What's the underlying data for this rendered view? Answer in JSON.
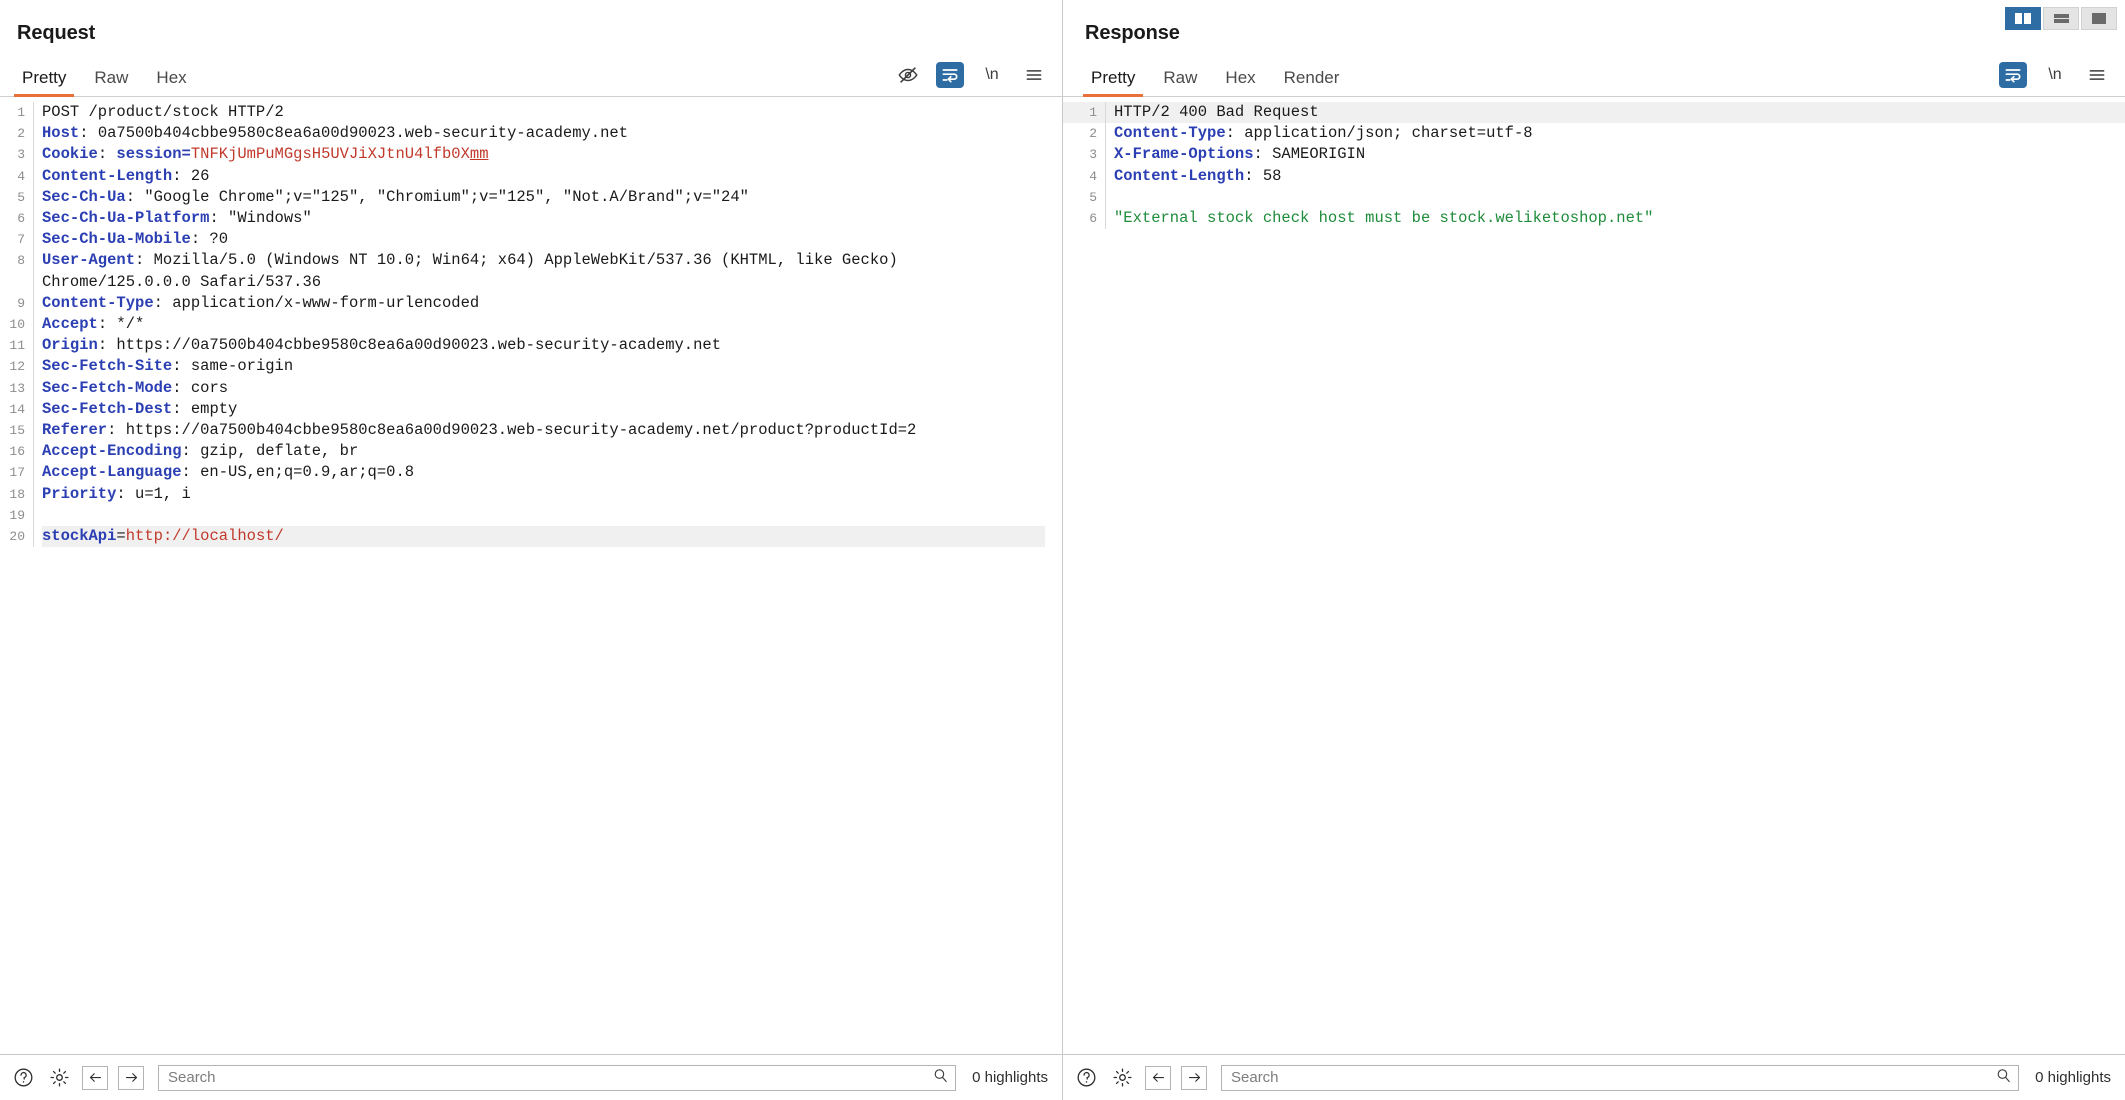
{
  "layout_toggle": {
    "buttons": [
      {
        "name": "side-by-side-layout",
        "label": "Side by side",
        "active": true
      },
      {
        "name": "stacked-layout",
        "label": "Stacked",
        "active": false
      },
      {
        "name": "single-layout",
        "label": "Single",
        "active": false
      }
    ]
  },
  "accent": {
    "tab_underline": "#e8703a",
    "active_tool": "#2e6da4",
    "header_blue": "#2b3fb3",
    "value_red": "#c0392b",
    "value_green": "#1e8c3a",
    "row_highlight": "#f0f0f0"
  },
  "request": {
    "title": "Request",
    "tabs": [
      {
        "label": "Pretty",
        "active": true
      },
      {
        "label": "Raw",
        "active": false
      },
      {
        "label": "Hex",
        "active": false
      }
    ],
    "tools": [
      {
        "name": "eye-off-icon",
        "label": "Show non-printable characters",
        "active": false
      },
      {
        "name": "word-wrap-icon",
        "label": "Word wrap",
        "active": true
      },
      {
        "name": "newline-icon",
        "label": "\\n",
        "active": false
      },
      {
        "name": "menu-icon",
        "label": "Menu",
        "active": false
      }
    ],
    "lines": [
      {
        "num": "1",
        "segments": [
          {
            "text": "POST /product/stock HTTP/2",
            "style": "plain"
          }
        ]
      },
      {
        "num": "2",
        "segments": [
          {
            "text": "Host",
            "style": "hdr"
          },
          {
            "text": ": 0a7500b404cbbe9580c8ea6a00d90023.web-security-academy.net",
            "style": "plain"
          }
        ]
      },
      {
        "num": "3",
        "segments": [
          {
            "text": "Cookie",
            "style": "hdr"
          },
          {
            "text": ": ",
            "style": "plain"
          },
          {
            "text": "session=",
            "style": "hdr"
          },
          {
            "text": "TNFKjUmPuMGgsH5UVJiXJtnU4lfb0X",
            "style": "red"
          },
          {
            "text": "mm",
            "style": "red-u"
          }
        ]
      },
      {
        "num": "4",
        "segments": [
          {
            "text": "Content-Length",
            "style": "hdr"
          },
          {
            "text": ": 26",
            "style": "plain"
          }
        ]
      },
      {
        "num": "5",
        "segments": [
          {
            "text": "Sec-Ch-Ua",
            "style": "hdr"
          },
          {
            "text": ": \"Google Chrome\";v=\"125\", \"Chromium\";v=\"125\", \"Not.A/Brand\";v=\"24\"",
            "style": "plain"
          }
        ]
      },
      {
        "num": "6",
        "segments": [
          {
            "text": "Sec-Ch-Ua-Platform",
            "style": "hdr"
          },
          {
            "text": ": \"Windows\"",
            "style": "plain"
          }
        ]
      },
      {
        "num": "7",
        "segments": [
          {
            "text": "Sec-Ch-Ua-Mobile",
            "style": "hdr"
          },
          {
            "text": ": ?0",
            "style": "plain"
          }
        ]
      },
      {
        "num": "8",
        "segments": [
          {
            "text": "User-Agent",
            "style": "hdr"
          },
          {
            "text": ": Mozilla/5.0 (Windows NT 10.0; Win64; x64) AppleWebKit/537.36 (KHTML, like Gecko) Chrome/125.0.0.0 Safari/537.36",
            "style": "plain"
          }
        ]
      },
      {
        "num": "9",
        "segments": [
          {
            "text": "Content-Type",
            "style": "hdr"
          },
          {
            "text": ": application/x-www-form-urlencoded",
            "style": "plain"
          }
        ]
      },
      {
        "num": "10",
        "segments": [
          {
            "text": "Accept",
            "style": "hdr"
          },
          {
            "text": ": */*",
            "style": "plain"
          }
        ]
      },
      {
        "num": "11",
        "segments": [
          {
            "text": "Origin",
            "style": "hdr"
          },
          {
            "text": ": https://0a7500b404cbbe9580c8ea6a00d90023.web-security-academy.net",
            "style": "plain"
          }
        ]
      },
      {
        "num": "12",
        "segments": [
          {
            "text": "Sec-Fetch-Site",
            "style": "hdr"
          },
          {
            "text": ": same-origin",
            "style": "plain"
          }
        ]
      },
      {
        "num": "13",
        "segments": [
          {
            "text": "Sec-Fetch-Mode",
            "style": "hdr"
          },
          {
            "text": ": cors",
            "style": "plain"
          }
        ]
      },
      {
        "num": "14",
        "segments": [
          {
            "text": "Sec-Fetch-Dest",
            "style": "hdr"
          },
          {
            "text": ": empty",
            "style": "plain"
          }
        ]
      },
      {
        "num": "15",
        "segments": [
          {
            "text": "Referer",
            "style": "hdr"
          },
          {
            "text": ": https://0a7500b404cbbe9580c8ea6a00d90023.web-security-academy.net/product?productId=2",
            "style": "plain"
          }
        ]
      },
      {
        "num": "16",
        "segments": [
          {
            "text": "Accept-Encoding",
            "style": "hdr"
          },
          {
            "text": ": gzip, deflate, br",
            "style": "plain"
          }
        ]
      },
      {
        "num": "17",
        "segments": [
          {
            "text": "Accept-Language",
            "style": "hdr"
          },
          {
            "text": ": en-US,en;q=0.9,ar;q=0.8",
            "style": "plain"
          }
        ]
      },
      {
        "num": "18",
        "segments": [
          {
            "text": "Priority",
            "style": "hdr"
          },
          {
            "text": ": u=1, i",
            "style": "plain"
          }
        ]
      },
      {
        "num": "19",
        "segments": [
          {
            "text": "",
            "style": "plain"
          }
        ]
      },
      {
        "num": "20",
        "highlight": true,
        "segments": [
          {
            "text": "stockApi",
            "style": "hdr"
          },
          {
            "text": "=",
            "style": "plain"
          },
          {
            "text": "http://localhost/",
            "style": "red"
          }
        ]
      }
    ],
    "statusbar": {
      "help_icon": "help-icon",
      "settings_icon": "gear-icon",
      "back_icon": "arrow-left-icon",
      "forward_icon": "arrow-right-icon",
      "search_placeholder": "Search",
      "search_value": "",
      "search_icon": "search-icon",
      "highlights": "0 highlights"
    }
  },
  "response": {
    "title": "Response",
    "tabs": [
      {
        "label": "Pretty",
        "active": true
      },
      {
        "label": "Raw",
        "active": false
      },
      {
        "label": "Hex",
        "active": false
      },
      {
        "label": "Render",
        "active": false
      }
    ],
    "tools": [
      {
        "name": "word-wrap-icon",
        "label": "Word wrap",
        "active": true
      },
      {
        "name": "newline-icon",
        "label": "\\n",
        "active": false
      },
      {
        "name": "menu-icon",
        "label": "Menu",
        "active": false
      }
    ],
    "lines": [
      {
        "num": "1",
        "highlight_full": true,
        "segments": [
          {
            "text": "HTTP/2 400 Bad Request",
            "style": "plain"
          }
        ]
      },
      {
        "num": "2",
        "segments": [
          {
            "text": "Content-Type",
            "style": "hdr"
          },
          {
            "text": ": application/json; charset=utf-8",
            "style": "plain"
          }
        ]
      },
      {
        "num": "3",
        "segments": [
          {
            "text": "X-Frame-Options",
            "style": "hdr"
          },
          {
            "text": ": SAMEORIGIN",
            "style": "plain"
          }
        ]
      },
      {
        "num": "4",
        "segments": [
          {
            "text": "Content-Length",
            "style": "hdr"
          },
          {
            "text": ": 58",
            "style": "plain"
          }
        ]
      },
      {
        "num": "5",
        "segments": [
          {
            "text": "",
            "style": "plain"
          }
        ]
      },
      {
        "num": "6",
        "segments": [
          {
            "text": "\"External stock check host must be stock.weliketoshop.net\"",
            "style": "green"
          }
        ]
      }
    ],
    "statusbar": {
      "help_icon": "help-icon",
      "settings_icon": "gear-icon",
      "back_icon": "arrow-left-icon",
      "forward_icon": "arrow-right-icon",
      "search_placeholder": "Search",
      "search_value": "",
      "search_icon": "search-icon",
      "highlights": "0 highlights"
    }
  }
}
